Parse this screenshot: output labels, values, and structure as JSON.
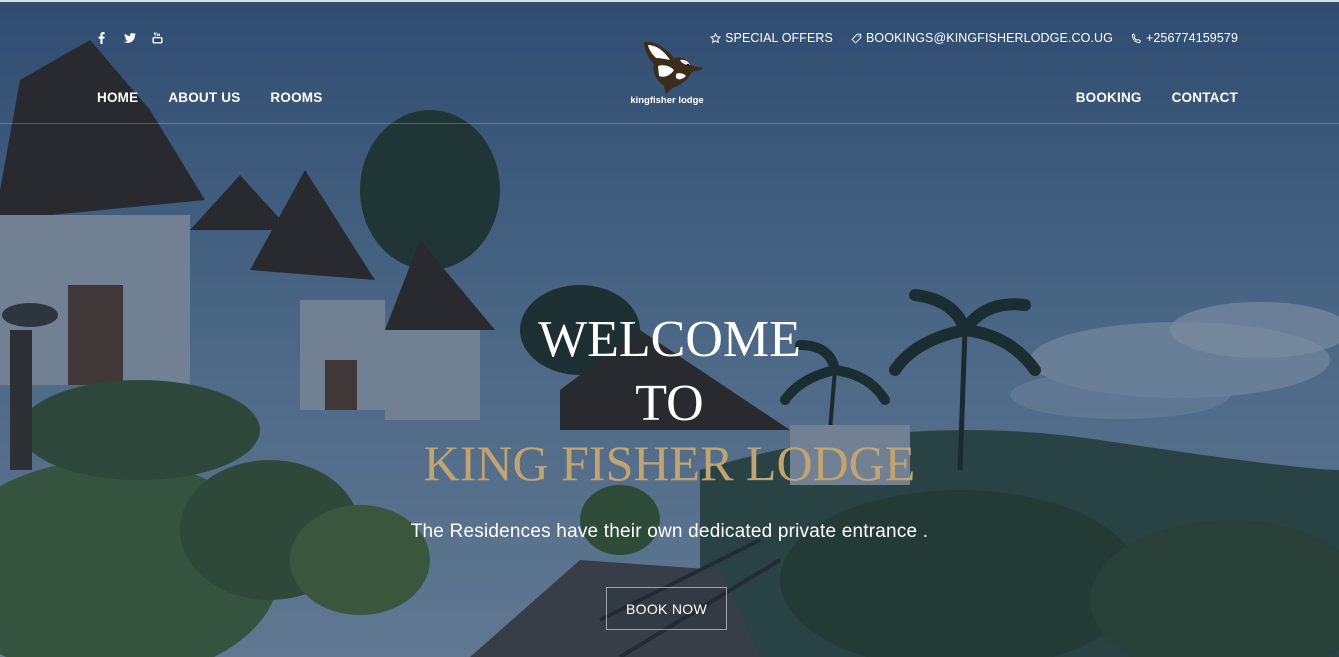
{
  "header": {
    "social": [
      {
        "name": "facebook-icon"
      },
      {
        "name": "twitter-icon"
      },
      {
        "name": "youtube-icon"
      }
    ],
    "contacts": {
      "offers": "SPECIAL OFFERS",
      "email": "BOOKINGS@KINGFISHERLODGE.CO.UG",
      "phone": "+256774159579"
    },
    "nav_left": [
      "HOME",
      "ABOUT US",
      "ROOMS"
    ],
    "nav_right": [
      "BOOKING",
      "CONTACT"
    ],
    "logo_text": "kingfisher lodge"
  },
  "hero": {
    "line1": "WELCOME",
    "line2": "TO",
    "line3": "KING FISHER LODGE",
    "subtitle": "The Residences have their own dedicated private entrance .",
    "cta": "BOOK NOW"
  },
  "colors": {
    "accent_gold": "#c2a473",
    "overlay": "#182e4e",
    "text": "#ffffff"
  }
}
